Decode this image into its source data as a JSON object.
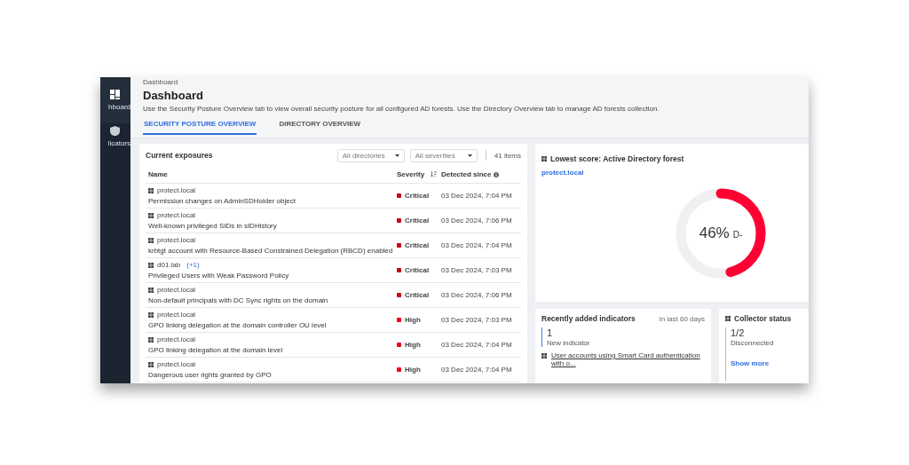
{
  "sidebar": {
    "items": [
      {
        "label": "hboard",
        "selected": true
      },
      {
        "label": "licators",
        "selected": false
      }
    ]
  },
  "breadcrumb": "Dashboard",
  "title": "Dashboard",
  "description": "Use the Security Posture Overview tab to view overall security posture for all configured AD forests. Use the Directory Overview tab to manage AD forests collection.",
  "tabs": [
    {
      "label": "SECURITY POSTURE OVERVIEW",
      "selected": true
    },
    {
      "label": "DIRECTORY OVERVIEW",
      "selected": false
    }
  ],
  "exposures": {
    "title": "Current exposures",
    "filters": [
      {
        "value": "All directories"
      },
      {
        "value": "All severities"
      }
    ],
    "count": "41 items",
    "columns": [
      "Name",
      "Severity",
      "Detected since"
    ],
    "rows": [
      {
        "domain": "protect.local",
        "name": "Permission changes on AdminSDHolder object",
        "severity": "Critical",
        "color": "#c8001a",
        "detected": "03 Dec 2024, 7:04 PM"
      },
      {
        "domain": "protect.local",
        "name": "Well-known privileged SIDs in sIDHistory",
        "severity": "Critical",
        "color": "#c8001a",
        "detected": "03 Dec 2024, 7:06 PM"
      },
      {
        "domain": "protect.local",
        "name": "krbtgt account with Resource-Based Constrained Delegation (RBCD) enabled",
        "severity": "Critical",
        "color": "#c8001a",
        "detected": "03 Dec 2024, 7:04 PM"
      },
      {
        "domain": "d01.lab",
        "extra": "(+1)",
        "name": "Privileged Users with Weak Password Policy",
        "severity": "Critical",
        "color": "#c8001a",
        "detected": "03 Dec 2024, 7:03 PM"
      },
      {
        "domain": "protect.local",
        "name": "Non-default principals with DC Sync rights on the domain",
        "severity": "Critical",
        "color": "#c8001a",
        "detected": "03 Dec 2024, 7:06 PM"
      },
      {
        "domain": "protect.local",
        "name": "GPO linking delegation at the domain controller OU level",
        "severity": "High",
        "color": "#f0001e",
        "detected": "03 Dec 2024, 7:03 PM"
      },
      {
        "domain": "protect.local",
        "name": "GPO linking delegation at the domain level",
        "severity": "High",
        "color": "#f0001e",
        "detected": "03 Dec 2024, 7:04 PM"
      },
      {
        "domain": "protect.local",
        "name": "Dangerous user rights granted by GPO",
        "severity": "High",
        "color": "#f0001e",
        "detected": "03 Dec 2024, 7:04 PM"
      }
    ]
  },
  "score": {
    "title": "Lowest score: Active Directory forest",
    "link": "protect.local",
    "level": 0.46,
    "percent": "46%",
    "grade": "D-"
  },
  "recent": {
    "title": "Recently added indicators",
    "period": "in last 60 days",
    "count": "1",
    "caption": "New indicator",
    "item": "User accounts using Smart Card authentication with o..."
  },
  "collector": {
    "title": "Collector status",
    "count": "1/2",
    "caption": "Disconnected",
    "link": "Show more"
  }
}
